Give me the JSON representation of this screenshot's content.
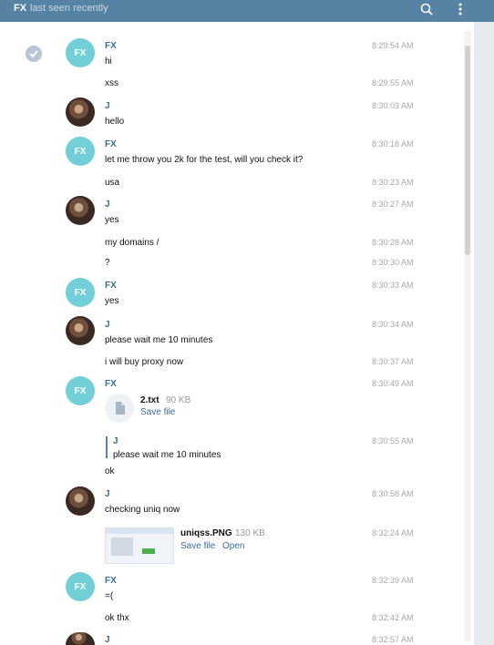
{
  "header": {
    "title": "FX",
    "status": "last seen recently"
  },
  "messages": [
    {
      "name": "FX",
      "text": "hi",
      "time": "8:29:54 AM"
    },
    {
      "text": "xss",
      "time": "8:29:55 AM"
    },
    {
      "name": "J",
      "text": "hello",
      "time": "8:30:03 AM"
    },
    {
      "name": "FX",
      "text": "let me throw you 2k for the test, will you check it?",
      "time": "8:30:18 AM"
    },
    {
      "text": "usa",
      "time": "8:30:23 AM"
    },
    {
      "name": "J",
      "text": "yes",
      "time": "8:30:27 AM"
    },
    {
      "text": "my domains /",
      "time": "8:30:28 AM"
    },
    {
      "text": "?",
      "time": "8:30:30 AM"
    },
    {
      "name": "FX",
      "text": "yes",
      "time": "8:30:33 AM"
    },
    {
      "name": "J",
      "text": "please wait me 10 minutes",
      "time": "8:30:34 AM"
    },
    {
      "text": "i will buy proxy now",
      "time": "8:30:37 AM"
    },
    {
      "name": "FX",
      "file_name": "2.txt",
      "file_size": "90 KB",
      "save_label": "Save file",
      "time": "8:30:49 AM"
    },
    {
      "reply_name": "J",
      "reply_text": "please wait me 10 minutes",
      "text": "ok",
      "time": "8:30:55 AM"
    },
    {
      "name": "J",
      "text": "checking uniq now",
      "time": "8:30:58 AM"
    },
    {
      "file_name": "uniqss.PNG",
      "file_size": "130 KB",
      "save_label": "Save file",
      "open_label": "Open",
      "time": "8:32:24 AM"
    },
    {
      "name": "FX",
      "text": "=(",
      "time": "8:32:39 AM"
    },
    {
      "text": "ok thx",
      "time": "8:32:42 AM"
    },
    {
      "name": "J",
      "time": "8:32:57 AM"
    }
  ],
  "avatar_initials": "FX",
  "icons": {
    "search": "search-icon",
    "more": "more-vertical-icon",
    "check": "check-icon",
    "file": "file-icon"
  },
  "colors": {
    "header": "#5682a3",
    "name": "#3a6d99",
    "fx_avatar": "#72cfd7"
  }
}
